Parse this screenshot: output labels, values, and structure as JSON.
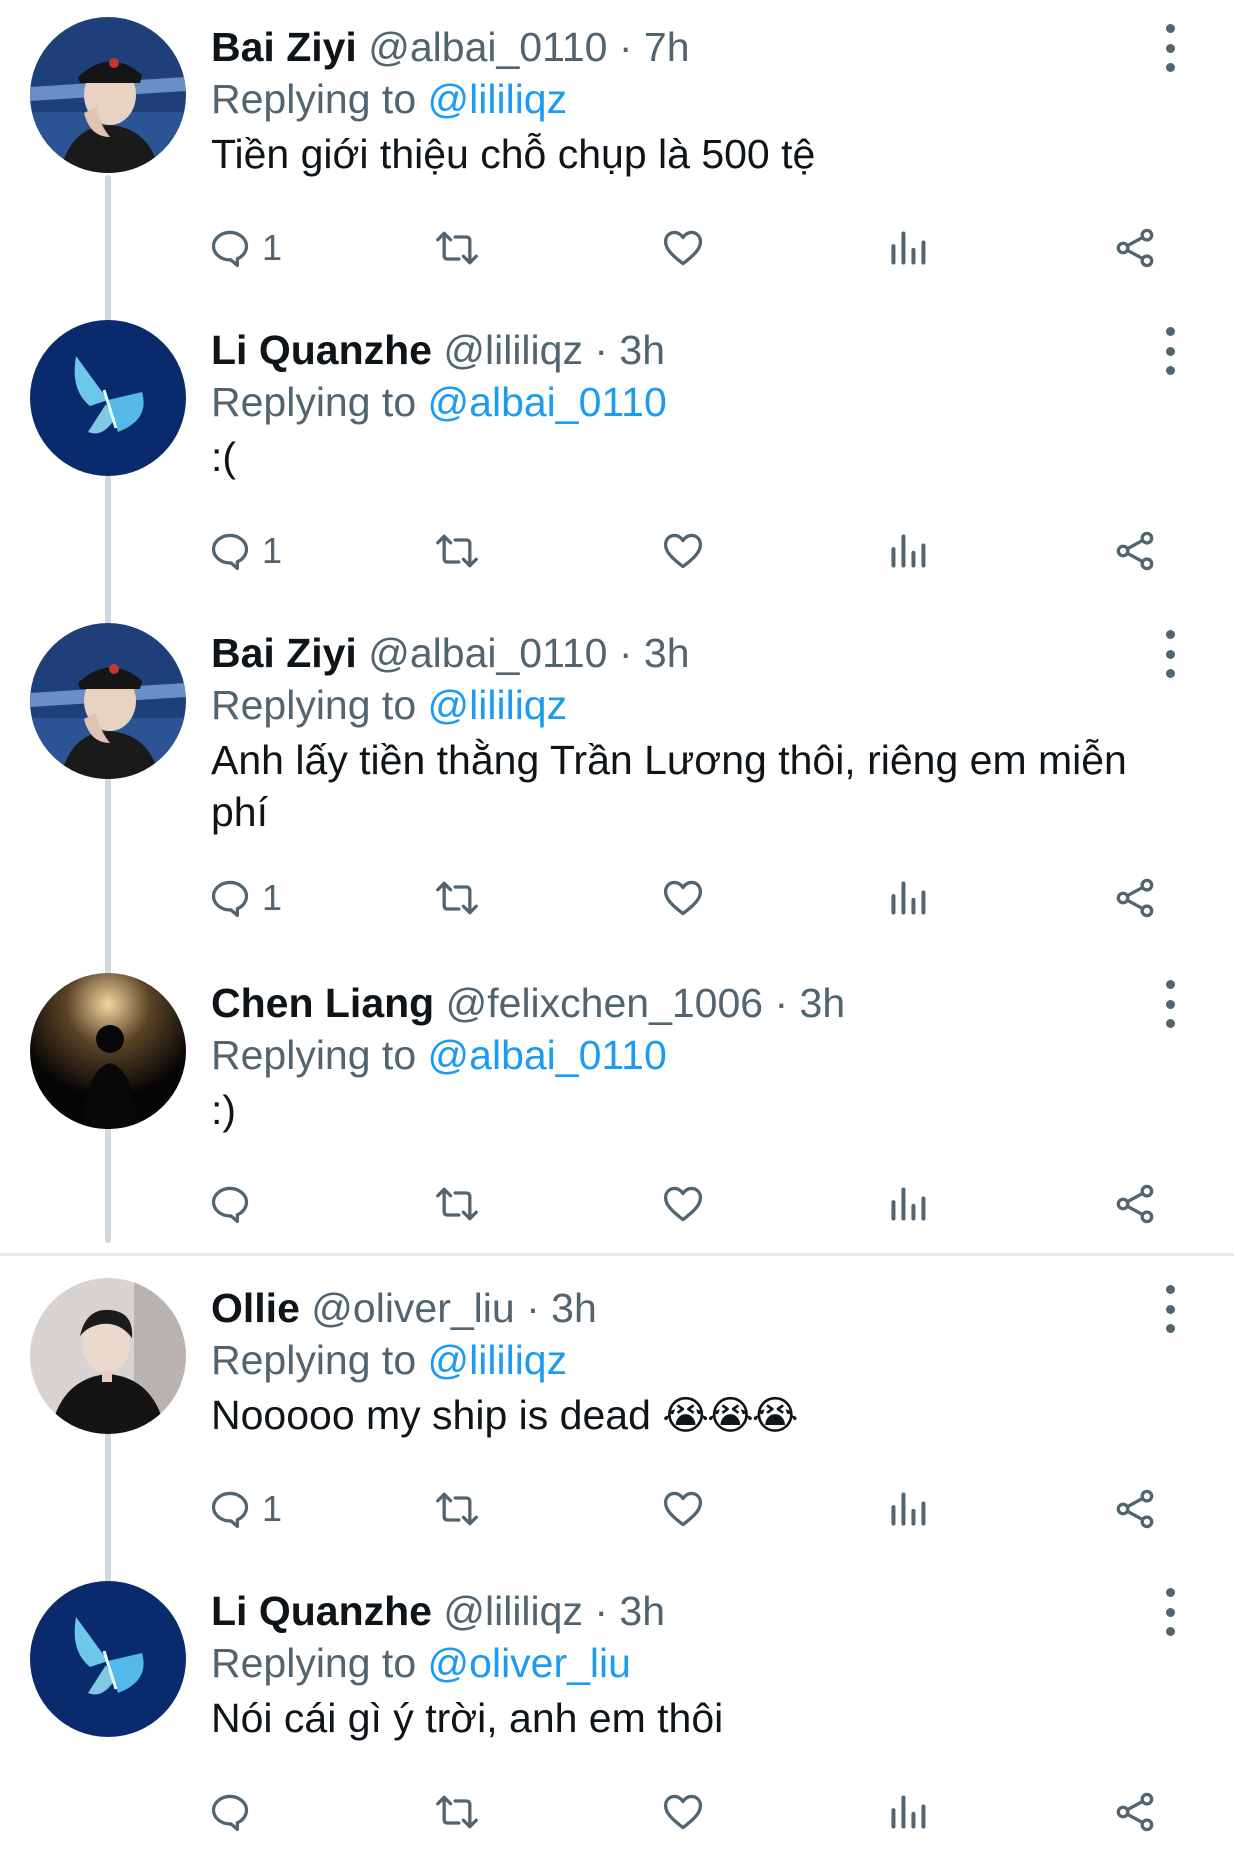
{
  "tweets": [
    {
      "name": "Bai Ziyi",
      "handle": "@albai_0110",
      "sep": "·",
      "time": "7h",
      "replying_label": "Replying to",
      "reply_to": "@lililiqz",
      "text": "Tiền giới thiệu chỗ chụp là 500 tệ",
      "reply_count": "1",
      "avatar": "avatar-cap-boy"
    },
    {
      "name": "Li Quanzhe",
      "handle": "@lililiqz",
      "sep": "·",
      "time": "3h",
      "replying_label": "Replying to",
      "reply_to": "@albai_0110",
      "text": ":(",
      "reply_count": "1",
      "avatar": "avatar-butterfly"
    },
    {
      "name": "Bai Ziyi",
      "handle": "@albai_0110",
      "sep": "·",
      "time": "3h",
      "replying_label": "Replying to",
      "reply_to": "@lililiqz",
      "text": "Anh lấy tiền thằng Trần Lương thôi, riêng em miễn phí",
      "reply_count": "1",
      "avatar": "avatar-cap-boy"
    },
    {
      "name": "Chen Liang",
      "handle": "@felixchen_1006",
      "sep": "·",
      "time": "3h",
      "replying_label": "Replying to",
      "reply_to": "@albai_0110",
      "text": ":)",
      "reply_count": "",
      "avatar": "avatar-silhouette"
    },
    {
      "name": "Ollie",
      "handle": "@oliver_liu",
      "sep": "·",
      "time": "3h",
      "replying_label": "Replying to",
      "reply_to": "@lililiqz",
      "text": "Nooooo my ship is dead",
      "emoji": "😭😭😭",
      "reply_count": "1",
      "avatar": "avatar-portrait"
    },
    {
      "name": "Li Quanzhe",
      "handle": "@lililiqz",
      "sep": "·",
      "time": "3h",
      "replying_label": "Replying to",
      "reply_to": "@oliver_liu",
      "text": "Nói cái gì ý trời, anh em thôi",
      "reply_count": "",
      "avatar": "avatar-butterfly"
    }
  ],
  "colors": {
    "text": "#0f1419",
    "secondary": "#536471",
    "link": "#1d9bf0",
    "thread_line": "#cfd9de"
  },
  "icons": [
    "reply-icon",
    "retweet-icon",
    "like-icon",
    "views-icon",
    "share-icon",
    "more-icon"
  ]
}
